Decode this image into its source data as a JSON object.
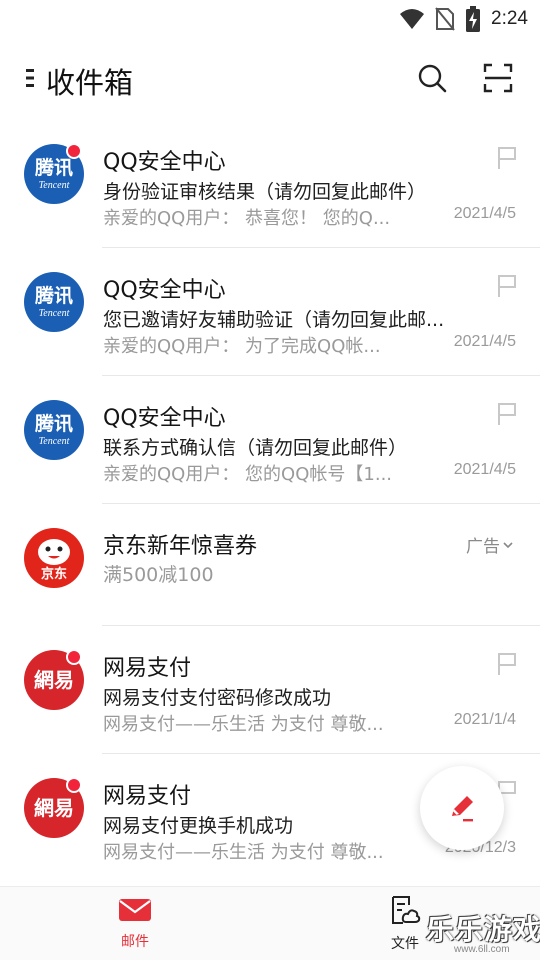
{
  "status_bar": {
    "time": "2:24"
  },
  "header": {
    "title": "收件箱"
  },
  "mails": [
    {
      "sender": "QQ安全中心",
      "subject": "身份验证审核结果（请勿回复此邮件）",
      "preview": "亲爱的QQ用户： 恭喜您！ 您的Q...",
      "date": "2021/4/5",
      "unread": true,
      "avatar": "tencent-logo"
    },
    {
      "sender": "QQ安全中心",
      "subject": "您已邀请好友辅助验证（请勿回复此邮...",
      "preview": "亲爱的QQ用户： 为了完成QQ帐...",
      "date": "2021/4/5",
      "unread": false,
      "avatar": "tencent-logo"
    },
    {
      "sender": "QQ安全中心",
      "subject": "联系方式确认信（请勿回复此邮件）",
      "preview": "亲爱的QQ用户： 您的QQ帐号【1...",
      "date": "2021/4/5",
      "unread": false,
      "avatar": "tencent-logo"
    }
  ],
  "ad": {
    "sender": "京东新年惊喜券",
    "subtitle": "满500减100",
    "badge": "广告",
    "avatar_text": "京东"
  },
  "mails2": [
    {
      "sender": "网易支付",
      "subject": "网易支付支付密码修改成功",
      "preview": "网易支付——乐生活 为支付 尊敬...",
      "date": "2021/1/4",
      "unread": true,
      "avatar": "netease-logo"
    },
    {
      "sender": "网易支付",
      "subject": "网易支付更换手机成功",
      "preview": "网易支付——乐生活 为支付 尊敬...",
      "date": "2020/12/3",
      "unread": true,
      "avatar": "netease-logo"
    }
  ],
  "logos": {
    "tencent_line1": "腾讯",
    "tencent_line2": "Tencent",
    "netease": "網易"
  },
  "bottom_nav": {
    "mail_label": "邮件",
    "files_label": "文件"
  },
  "watermark": {
    "main": "乐乐游戏",
    "sub": "www.6ll.com"
  },
  "colors": {
    "accent_red": "#e5303a",
    "tencent_blue": "#1a5fb4",
    "netease_red": "#d6252b",
    "jd_red": "#e1251b"
  }
}
